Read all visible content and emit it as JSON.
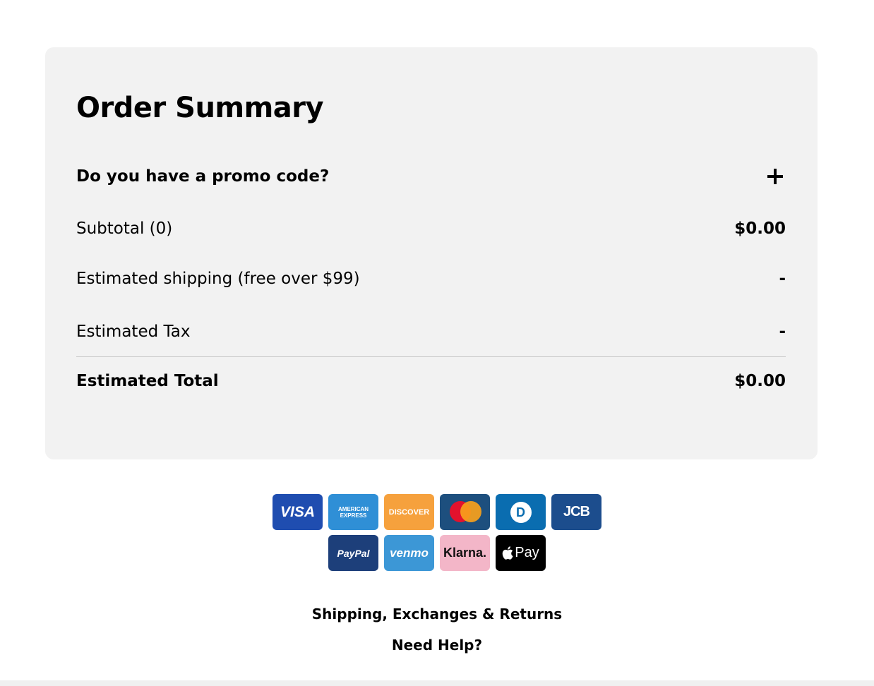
{
  "order_summary": {
    "title": "Order Summary",
    "promo": {
      "label": "Do you have a promo code?",
      "icon": "plus-icon"
    },
    "subtotal": {
      "label": "Subtotal (0)",
      "value": "$0.00"
    },
    "shipping": {
      "label": "Estimated shipping (free over $99)",
      "value": "-"
    },
    "tax": {
      "label": "Estimated Tax",
      "value": "-"
    },
    "total": {
      "label": "Estimated Total",
      "value": "$0.00"
    }
  },
  "payment_methods": {
    "row1": {
      "visa": "VISA",
      "amex": "AMERICAN EXPRESS",
      "discover": "DISCOVER",
      "mastercard": "mastercard-logo",
      "diners": "D",
      "jcb": "JCB"
    },
    "row2": {
      "paypal": "PayPal",
      "venmo": "venmo",
      "klarna": "Klarna.",
      "applepay": "Pay"
    }
  },
  "footer_links": {
    "shipping": "Shipping, Exchanges & Returns",
    "help": "Need Help?"
  },
  "colors": {
    "card_background": "#f2f2f2",
    "text": "#000000"
  }
}
